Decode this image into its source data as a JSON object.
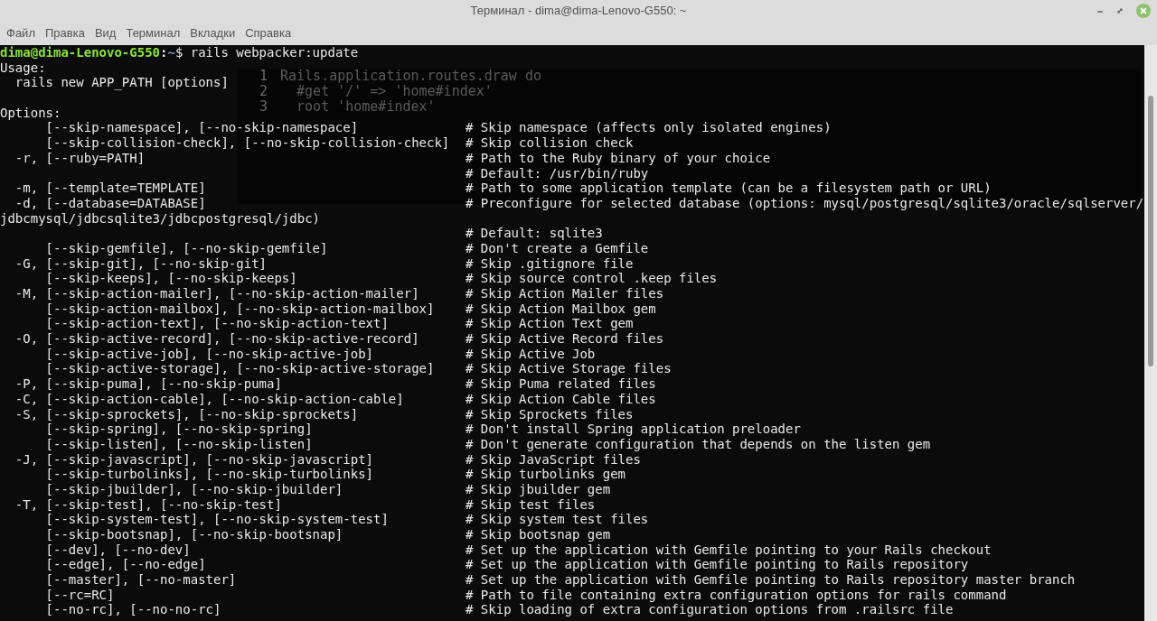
{
  "window": {
    "title": "Терминал - dima@dima-Lenovo-G550: ~"
  },
  "menu": [
    {
      "label": "Файл"
    },
    {
      "label": "Правка"
    },
    {
      "label": "Вид"
    },
    {
      "label": "Терминал"
    },
    {
      "label": "Вкладки"
    },
    {
      "label": "Справка"
    }
  ],
  "background_editor": {
    "lines": [
      {
        "number": "1",
        "code": "Rails.application.routes.draw do"
      },
      {
        "number": "2",
        "code": "  #get '/' => 'home#index'"
      },
      {
        "number": "3",
        "code": "  root 'home#index'"
      }
    ]
  },
  "terminal": {
    "prompt": {
      "user": "dima@dima-Lenovo-G550",
      "path": "~",
      "separator": ":",
      "command": "$ rails webpacker:update"
    },
    "lines": [
      {
        "text": "Usage:"
      },
      {
        "text": "  rails new APP_PATH [options]"
      },
      {
        "kind": "section",
        "text": "Options:"
      },
      {
        "text": "      [--skip-namespace], [--no-skip-namespace]",
        "comment": "# Skip namespace (affects only isolated engines)"
      },
      {
        "text": "      [--skip-collision-check], [--no-skip-collision-check]",
        "comment": "# Skip collision check"
      },
      {
        "text": "  -r, [--ruby=PATH]",
        "comment": "# Path to the Ruby binary of your choice"
      },
      {
        "comment": "# Default: /usr/bin/ruby"
      },
      {
        "text": "  -m, [--template=TEMPLATE]",
        "comment": "# Path to some application template (can be a filesystem path or URL)"
      },
      {
        "text": "  -d, [--database=DATABASE]",
        "comment": "# Preconfigure for selected database (options: mysql/postgresql/sqlite3/oracle/sqlserver/"
      },
      {
        "text": "jdbcmysql/jdbcsqlite3/jdbcpostgresql/jdbc)"
      },
      {
        "comment": "# Default: sqlite3"
      },
      {
        "text": "      [--skip-gemfile], [--no-skip-gemfile]",
        "comment": "# Don't create a Gemfile"
      },
      {
        "text": "  -G, [--skip-git], [--no-skip-git]",
        "comment": "# Skip .gitignore file"
      },
      {
        "text": "      [--skip-keeps], [--no-skip-keeps]",
        "comment": "# Skip source control .keep files"
      },
      {
        "text": "  -M, [--skip-action-mailer], [--no-skip-action-mailer]",
        "comment": "# Skip Action Mailer files"
      },
      {
        "text": "      [--skip-action-mailbox], [--no-skip-action-mailbox]",
        "comment": "# Skip Action Mailbox gem"
      },
      {
        "text": "      [--skip-action-text], [--no-skip-action-text]",
        "comment": "# Skip Action Text gem"
      },
      {
        "text": "  -O, [--skip-active-record], [--no-skip-active-record]",
        "comment": "# Skip Active Record files"
      },
      {
        "text": "      [--skip-active-job], [--no-skip-active-job]",
        "comment": "# Skip Active Job"
      },
      {
        "text": "      [--skip-active-storage], [--no-skip-active-storage]",
        "comment": "# Skip Active Storage files"
      },
      {
        "text": "  -P, [--skip-puma], [--no-skip-puma]",
        "comment": "# Skip Puma related files"
      },
      {
        "text": "  -C, [--skip-action-cable], [--no-skip-action-cable]",
        "comment": "# Skip Action Cable files"
      },
      {
        "text": "  -S, [--skip-sprockets], [--no-skip-sprockets]",
        "comment": "# Skip Sprockets files"
      },
      {
        "text": "      [--skip-spring], [--no-skip-spring]",
        "comment": "# Don't install Spring application preloader"
      },
      {
        "text": "      [--skip-listen], [--no-skip-listen]",
        "comment": "# Don't generate configuration that depends on the listen gem"
      },
      {
        "text": "  -J, [--skip-javascript], [--no-skip-javascript]",
        "comment": "# Skip JavaScript files"
      },
      {
        "text": "      [--skip-turbolinks], [--no-skip-turbolinks]",
        "comment": "# Skip turbolinks gem"
      },
      {
        "text": "      [--skip-jbuilder], [--no-skip-jbuilder]",
        "comment": "# Skip jbuilder gem"
      },
      {
        "text": "  -T, [--skip-test], [--no-skip-test]",
        "comment": "# Skip test files"
      },
      {
        "text": "      [--skip-system-test], [--no-skip-system-test]",
        "comment": "# Skip system test files"
      },
      {
        "text": "      [--skip-bootsnap], [--no-skip-bootsnap]",
        "comment": "# Skip bootsnap gem"
      },
      {
        "text": "      [--dev], [--no-dev]",
        "comment": "# Set up the application with Gemfile pointing to your Rails checkout"
      },
      {
        "text": "      [--edge], [--no-edge]",
        "comment": "# Set up the application with Gemfile pointing to Rails repository"
      },
      {
        "text": "      [--master], [--no-master]",
        "comment": "# Set up the application with Gemfile pointing to Rails repository master branch"
      },
      {
        "text": "      [--rc=RC]",
        "comment": "# Path to file containing extra configuration options for rails command"
      },
      {
        "text": "      [--no-rc], [--no-no-rc]",
        "comment": "# Skip loading of extra configuration options from .railsrc file"
      }
    ]
  }
}
